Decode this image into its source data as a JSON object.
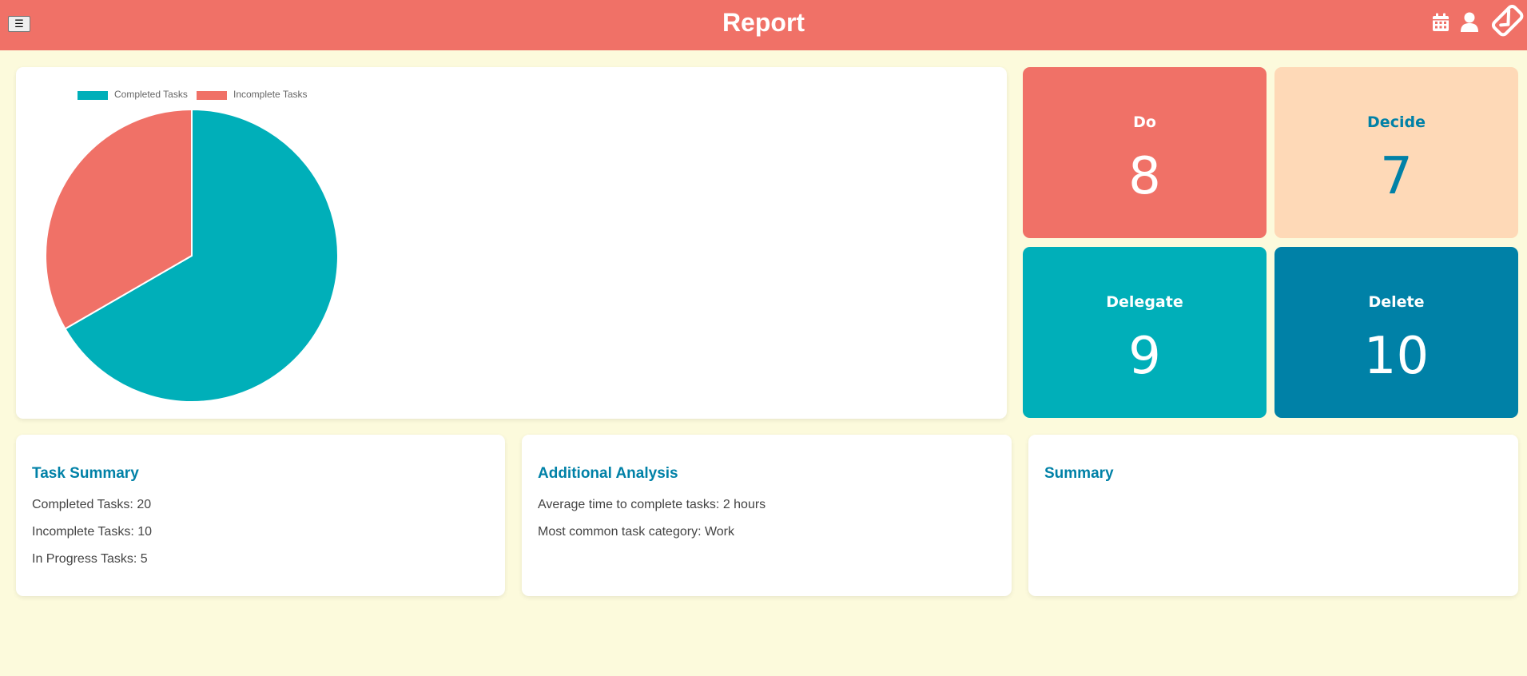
{
  "header": {
    "title": "Report",
    "menu_label": "☰",
    "icons": [
      "calendar-icon",
      "user-icon",
      "app-logo-icon"
    ]
  },
  "colors": {
    "header_bg": "#f07167",
    "page_bg": "#fcfadc",
    "completed": "#00afb9",
    "incomplete": "#f07167",
    "title_blue": "#0081a7",
    "decide_bg": "#fed9b7"
  },
  "chart_data": {
    "type": "pie",
    "title": "",
    "legend": [
      "Completed Tasks",
      "Incomplete Tasks"
    ],
    "legend_position": "top-left",
    "slices": [
      {
        "label": "Completed Tasks",
        "value": 20,
        "color": "#00afb9"
      },
      {
        "label": "Incomplete Tasks",
        "value": 10,
        "color": "#f07167"
      }
    ]
  },
  "quadrants": [
    {
      "label": "Do",
      "count": "8"
    },
    {
      "label": "Decide",
      "count": "7"
    },
    {
      "label": "Delegate",
      "count": "9"
    },
    {
      "label": "Delete",
      "count": "10"
    }
  ],
  "task_summary": {
    "title": "Task Summary",
    "lines": [
      "Completed Tasks: 20",
      "Incomplete Tasks: 10",
      "In Progress Tasks: 5"
    ]
  },
  "additional_analysis": {
    "title": "Additional Analysis",
    "lines": [
      "Average time to complete tasks: 2 hours",
      "Most common task category: Work"
    ]
  },
  "summary": {
    "title": "Summary"
  }
}
